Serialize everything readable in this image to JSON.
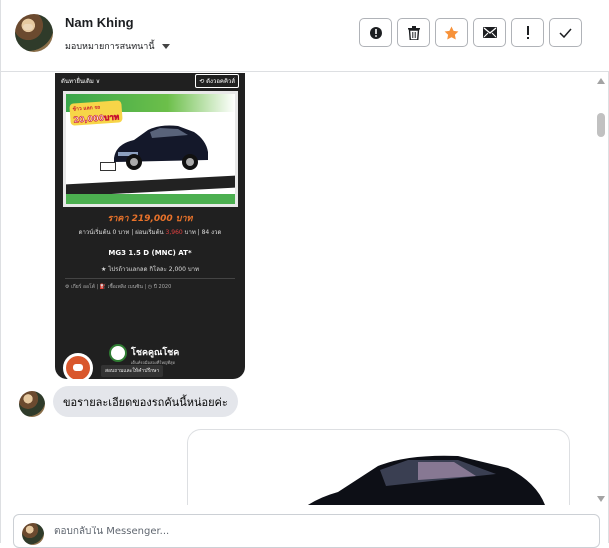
{
  "header": {
    "contact_name": "Nam Khing",
    "assign_label": "มอบหมายการสนทนานี้",
    "actions": [
      {
        "name": "spam-button",
        "icon": "alert-circle-icon"
      },
      {
        "name": "delete-button",
        "icon": "trash-icon"
      },
      {
        "name": "star-button",
        "icon": "star-icon",
        "color": "#f7923a"
      },
      {
        "name": "mark-unread-button",
        "icon": "envelope-icon"
      },
      {
        "name": "follow-up-button",
        "icon": "exclamation-icon"
      },
      {
        "name": "mark-done-button",
        "icon": "check-icon"
      }
    ]
  },
  "shared_image": {
    "top_left": "ดันทายื่นเดิม ∨",
    "top_right": "⟲ ดังวอคคิวส์",
    "ad_badge_top": "ข้าว แลก รถ",
    "ad_badge_value": "20,000บาท",
    "price": "ราคา 219,000 บาท",
    "terms_prefix": "ดาวน์เริ่มต้น 0 บาท | ผ่อนเริ่มต้น ",
    "terms_red": "3,960",
    "terms_suffix": " บาท | 84 งวด",
    "model": "MG3 1.5 D (MNC) AT*",
    "mileage": "★ ไปรถ้าวแลกลด กิโลละ 2,000 บาท",
    "meta": "⚙ เกียร์ ออโต้   |   ⛽ เชื้อเพลิง เบนซิน   |   ◷ ปี 2020",
    "logo_text": "โชคคูณโชค",
    "logo_sub": "เต็นท์รถมือสองที่ใหญ่ที่สุด",
    "tooltip": "สอบถามและให้คำปรึกษา"
  },
  "message": {
    "text": "ขอรายละเอียดของรถคันนี้หน่อยค่ะ"
  },
  "reply": {
    "placeholder": "ตอบกลับใน Messenger..."
  }
}
